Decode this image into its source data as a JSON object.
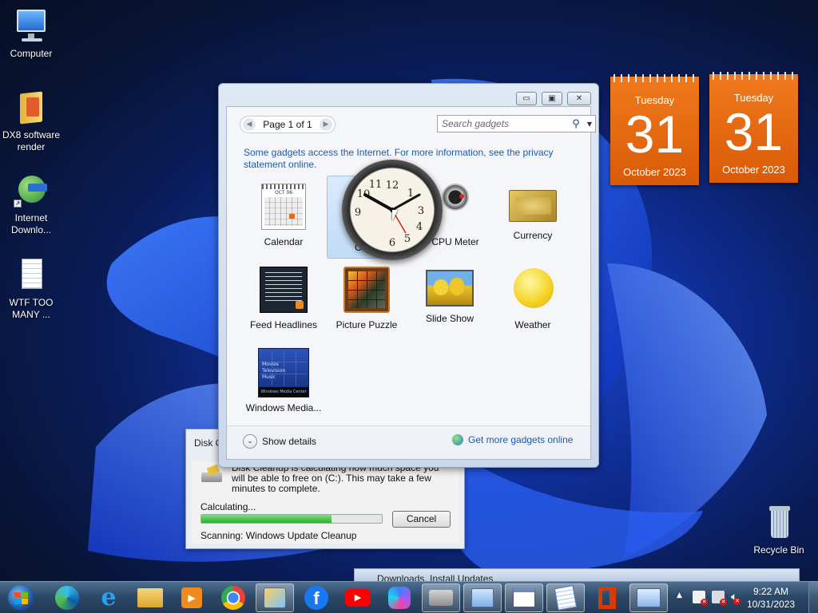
{
  "desktop": {
    "icons": [
      {
        "label": "Computer"
      },
      {
        "label": "DX8 software\nrender"
      },
      {
        "label": "Internet\nDownlo..."
      },
      {
        "label": "WTF TOO\nMANY ..."
      },
      {
        "label": "Recycle Bin"
      }
    ]
  },
  "gadget_window": {
    "pager": "Page 1 of 1",
    "search_placeholder": "Search gadgets",
    "info_text": "Some gadgets access the Internet.  For more information, see the privacy statement online.",
    "gadgets": [
      {
        "label": "Calendar"
      },
      {
        "label": "Clock"
      },
      {
        "label": "CPU Meter"
      },
      {
        "label": "Currency"
      },
      {
        "label": "Feed Headlines"
      },
      {
        "label": "Picture Puzzle"
      },
      {
        "label": "Slide Show"
      },
      {
        "label": "Weather"
      },
      {
        "label": "Windows Media..."
      }
    ],
    "show_details": "Show details",
    "get_more": "Get more gadgets online",
    "calendar_thumb_month": "OCT 06",
    "media_thumb_lines": [
      "Movies",
      "Television",
      "Music"
    ],
    "media_thumb_footer": "Windows Media Center"
  },
  "disk_cleanup": {
    "title": "Disk C",
    "message": "Disk Cleanup is calculating how much space you will be able to free on  (C:). This may take a few minutes to complete.",
    "calculating": "Calculating...",
    "progress": 0.72,
    "cancel": "Cancel",
    "scanning": "Scanning:  Windows Update Cleanup"
  },
  "calendars": [
    {
      "day": "Tuesday",
      "date": "31",
      "month": "October 2023"
    },
    {
      "day": "Tuesday",
      "date": "31",
      "month": "October 2023"
    }
  ],
  "taskbar": {
    "apps": [
      "start-orb",
      "edge",
      "internet-explorer",
      "file-explorer",
      "media-player",
      "chrome",
      "paint",
      "facebook",
      "youtube",
      "copilot",
      "disk-cleanup",
      "control-panel",
      "remote-desktop",
      "notepad",
      "office",
      "gadgets"
    ],
    "peek_title": "Downloads, Install Updates",
    "clock_time": "9:22 AM",
    "clock_date": "10/31/2023"
  },
  "colors": {
    "accent_orange": "#e8690f",
    "link_blue": "#1e5aa8",
    "progress_green": "#3fbf3f"
  }
}
